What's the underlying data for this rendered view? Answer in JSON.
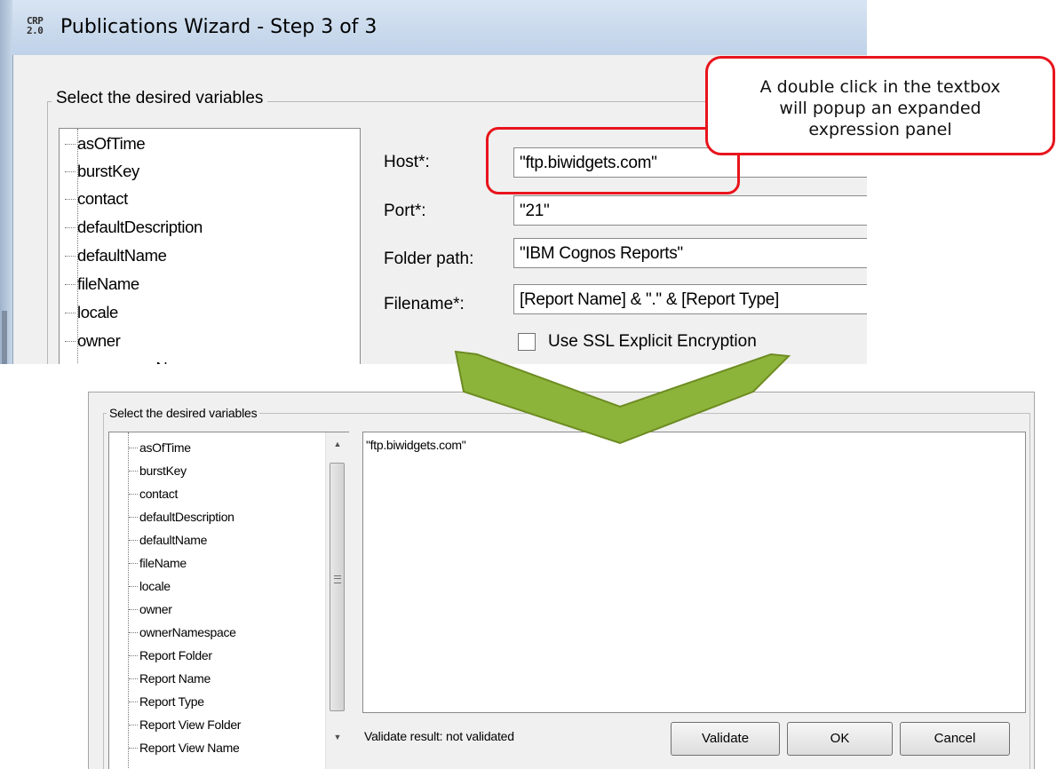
{
  "top_window": {
    "logo": [
      "CRP",
      "2.0"
    ],
    "title": "Publications Wizard - Step 3 of 3",
    "group_label": "Select the desired variables",
    "variables": [
      "asOfTime",
      "burstKey",
      "contact",
      "defaultDescription",
      "defaultName",
      "fileName",
      "locale",
      "owner",
      "ownerN"
    ],
    "fields": {
      "host": {
        "label": "Host*:",
        "value": "\"ftp.biwidgets.com\""
      },
      "port": {
        "label": "Port*:",
        "value": "\"21\""
      },
      "folder_path": {
        "label": "Folder path:",
        "value": "\"IBM Cognos Reports\""
      },
      "filename": {
        "label": "Filename*:",
        "value": "[Report Name] & \".\" & [Report Type]"
      }
    },
    "ssl_checkbox": {
      "label": "Use SSL Explicit Encryption",
      "checked": false
    }
  },
  "callout": {
    "lines": [
      "A double click in the textbox",
      "will popup an expanded",
      "expression panel"
    ],
    "border_color": "#e8141c"
  },
  "arrow": {
    "fill_color": "#8db43a",
    "stroke_color": "#6d8c22"
  },
  "expanded_panel": {
    "group_label": "Select the desired variables",
    "variables": [
      "asOfTime",
      "burstKey",
      "contact",
      "defaultDescription",
      "defaultName",
      "fileName",
      "locale",
      "owner",
      "ownerNamespace",
      "Report Folder",
      "Report Name",
      "Report Type",
      "Report View Folder",
      "Report View Name"
    ],
    "expression_text": "\"ftp.biwidgets.com\"",
    "validate_result": "Validate result: not validated",
    "buttons": {
      "validate": "Validate",
      "ok": "OK",
      "cancel": "Cancel"
    },
    "scroll_icons": {
      "up": "▲",
      "down": "▼"
    }
  }
}
